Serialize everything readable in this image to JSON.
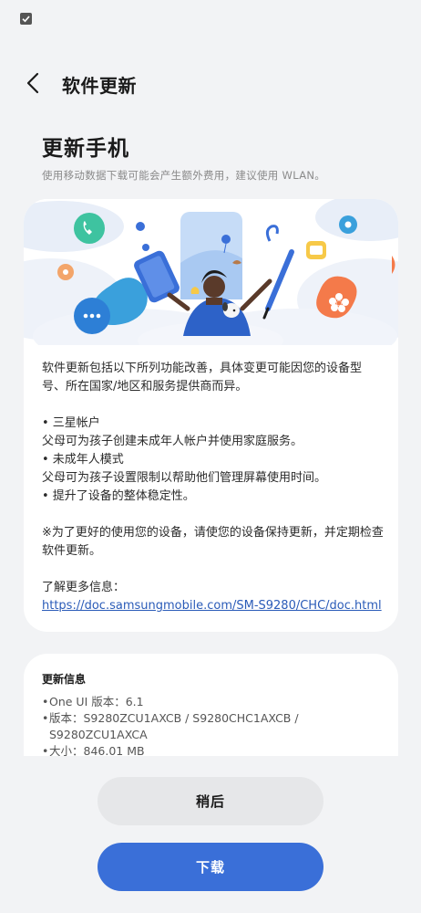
{
  "header": {
    "title": "软件更新"
  },
  "main": {
    "title": "更新手机",
    "subtitle": "使用移动数据下载可能会产生额外费用，建议使用 WLAN。"
  },
  "details": {
    "intro_lines": [
      "软件更新包括以下所列功能改善，具体变更可能因您的设备型",
      "号、所在国家/地区和服务提供商而异。"
    ],
    "features": [
      {
        "heading": "• 三星帐户",
        "text": "父母可为孩子创建未成年人帐户并使用家庭服务。"
      },
      {
        "heading": "• 未成年人模式",
        "text": "父母可为孩子设置限制以帮助他们管理屏幕使用时间。"
      },
      {
        "heading": "• 提升了设备的整体稳定性。",
        "text": ""
      }
    ],
    "note_lines": [
      "※为了更好的使用您的设备，请使您的设备保持更新，并定期检查",
      "软件更新。"
    ],
    "more_info_label": "了解更多信息：",
    "more_info_link": "https://doc.samsungmobile.com/SM-S9280/CHC/doc.html"
  },
  "update_info": {
    "title": "更新信息",
    "items": [
      {
        "bullet": "•",
        "text": "One UI 版本：6.1"
      },
      {
        "bullet": "•",
        "text": "版本：S9280ZCU1AXCB / S9280CHC1AXCB /"
      },
      {
        "bullet": "",
        "text": "S9280ZCU1AXCA"
      },
      {
        "bullet": "•",
        "text": "大小：846.01 MB"
      }
    ]
  },
  "buttons": {
    "later": "稍后",
    "download": "下载"
  },
  "colors": {
    "accent": "#3a6fd8",
    "link": "#2a5bb8",
    "background": "#f2f3f5"
  }
}
